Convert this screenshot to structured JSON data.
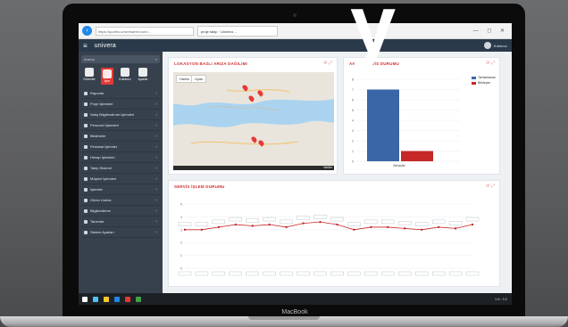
{
  "browser": {
    "address": "https://quotes.universanet.com/...",
    "tab": "proje takip · Univera ...",
    "controls": "— ◻ ✕"
  },
  "app": {
    "brand": "univera",
    "user": "Kullanıcı"
  },
  "sidebar": {
    "search_placeholder": "Arama",
    "quick": [
      {
        "label": "Görevler",
        "icon": "tasks-icon"
      },
      {
        "label": "İşler",
        "icon": "jobs-icon"
      },
      {
        "label": "Kullanıcı",
        "icon": "user-icon"
      },
      {
        "label": "Ayarlar",
        "icon": "settings-icon"
      }
    ],
    "items": [
      "Raporlar",
      "Proje İşlemleri",
      "Satış Bilgilendirme İşlemleri",
      "Personel İşlemleri",
      "Bildirimler",
      "Finansal İşlemler",
      "Hesap İşlemleri",
      "Talep Sistemi",
      "Müşteri İşlemleri",
      "İşlemler",
      "Görev Listesi",
      "Bilgilendirme",
      "Tanımlar",
      "Sistem Ayarları"
    ]
  },
  "panels": {
    "map": {
      "title": "LOKASYON BAZLI ARIZA DAĞILIMI",
      "tabs": [
        "Harita",
        "Uydu"
      ],
      "footer": "Veriler"
    },
    "status": {
      "title": "AKTİF SERVİS DURUMU",
      "legend": [
        {
          "name": "Tamamlanan",
          "color": "#3a66a7"
        },
        {
          "name": "Bekleyen",
          "color": "#c62828"
        }
      ],
      "x_label": "Servisler"
    },
    "trend": {
      "title": "SERVİS İŞLEM DURUMU"
    }
  },
  "chart_data": [
    {
      "type": "bar",
      "categories": [
        "Servisler"
      ],
      "series": [
        {
          "name": "Tamamlanan",
          "values": [
            7
          ]
        },
        {
          "name": "Bekleyen",
          "values": [
            1
          ]
        }
      ],
      "y_ticks": [
        "8",
        "7",
        "6",
        "5",
        "4",
        "3",
        "2",
        "1",
        "0"
      ],
      "ylim": [
        0,
        8
      ]
    },
    {
      "type": "line",
      "x": [
        1,
        2,
        3,
        4,
        5,
        6,
        7,
        8,
        9,
        10,
        11,
        12,
        13,
        14,
        15,
        16,
        17,
        18
      ],
      "values": [
        3,
        3,
        3.2,
        3.4,
        3.3,
        3.4,
        3.2,
        3.5,
        3.6,
        3.4,
        3,
        3.2,
        3.2,
        3.1,
        3,
        3.2,
        3.1,
        3.4
      ],
      "y_ticks": [
        "5",
        "4",
        "3",
        "2",
        "1",
        "0"
      ],
      "ylim": [
        0,
        5
      ]
    }
  ],
  "colors": {
    "accent": "#d32f2f",
    "sidebar": "#36414d",
    "header": "#2b3a4a"
  },
  "taskbar": {
    "clock": "16:32"
  },
  "laptop_label": "MacBook",
  "overlay_letter": "y"
}
